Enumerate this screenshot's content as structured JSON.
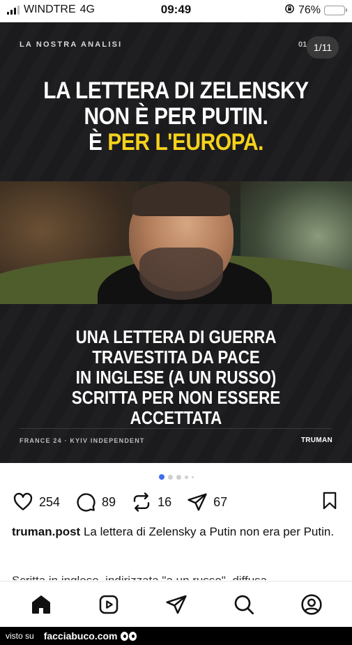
{
  "status_bar": {
    "carrier": "WINDTRE",
    "network": "4G",
    "time": "09:49",
    "battery": "76%",
    "battery_level": 0.76,
    "battery_color": "#f3c200"
  },
  "post_image": {
    "kicker": "LA NOSTRA ANALISI",
    "page_number": "01",
    "counter": "1/11",
    "headline_line1": "LA LETTERA DI ZELENSKY",
    "headline_line2": "NON È PER PUTIN.",
    "headline_line3_prefix": "È ",
    "headline_line3_highlight": "PER L'EUROPA.",
    "highlight_color": "#f5d21b",
    "subtext_lines": [
      "UNA LETTERA DI GUERRA",
      "TRAVESTITA DA PACE",
      "IN INGLESE (A UN RUSSO)",
      "SCRITTA PER NON ESSERE ACCETTATA"
    ],
    "source": "FRANCE 24 · KYIV INDEPENDENT",
    "brand": "TRUMAN"
  },
  "carousel": {
    "active_index": 0,
    "active_color": "#3f6ef0"
  },
  "actions": {
    "likes": "254",
    "comments": "89",
    "reposts": "16",
    "shares": "67",
    "icons": [
      "heart-icon",
      "comment-icon",
      "repost-icon",
      "send-icon",
      "bookmark-icon"
    ]
  },
  "caption": {
    "username": "truman.post",
    "text": "La lettera di Zelensky a Putin non era per Putin.",
    "more_text": "Scritta in inglese, indirizzata \"a un russo\", diffusa"
  },
  "nav": {
    "items": [
      "home-icon",
      "reels-icon",
      "send-icon",
      "search-icon",
      "profile-icon"
    ]
  },
  "watermark": {
    "prefix": "visto su",
    "site": "facciabuco.com"
  }
}
